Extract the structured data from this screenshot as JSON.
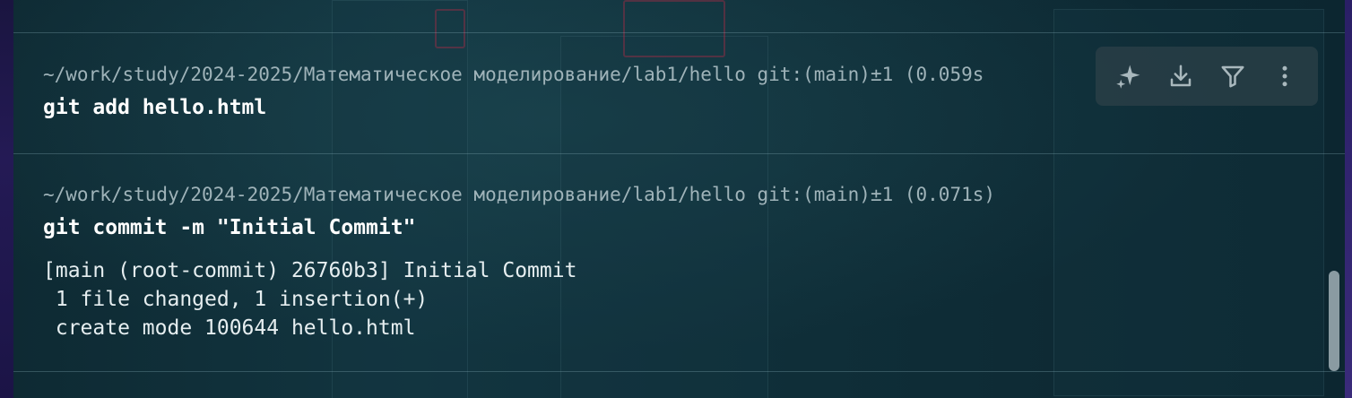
{
  "terminal": {
    "blocks": [
      {
        "prompt": "~/work/study/2024-2025/Математическое моделирование/lab1/hello git:(main)±1 (0.059s",
        "command": "git add hello.html",
        "output": ""
      },
      {
        "prompt": "~/work/study/2024-2025/Математическое моделирование/lab1/hello git:(main)±1 (0.071s)",
        "command": "git commit -m \"Initial Commit\"",
        "output": "[main (root-commit) 26760b3] Initial Commit\n 1 file changed, 1 insertion(+)\n create mode 100644 hello.html"
      }
    ]
  },
  "toolbar": {
    "icons": [
      "sparkle-icon",
      "download-icon",
      "filter-icon",
      "more-vertical-icon"
    ]
  },
  "colors": {
    "prompt": "#9fb3b9",
    "command": "#ffffff",
    "output": "#e6eef0",
    "accent_frame": "#2a1f66"
  }
}
